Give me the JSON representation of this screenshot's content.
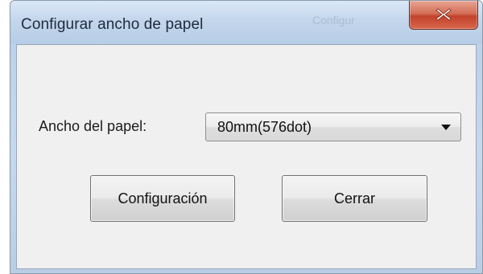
{
  "window": {
    "title": "Configurar ancho de papel",
    "background_title_text": "Configur"
  },
  "titlebar": {
    "close_icon": "close-icon",
    "close_color": "#c2432b"
  },
  "form": {
    "paper_width_label": "Ancho del papel:",
    "paper_width_value": "80mm(576dot)",
    "dropdown_icon": "chevron-down-icon"
  },
  "buttons": {
    "configure_label": "Configuración",
    "close_label": "Cerrar"
  }
}
